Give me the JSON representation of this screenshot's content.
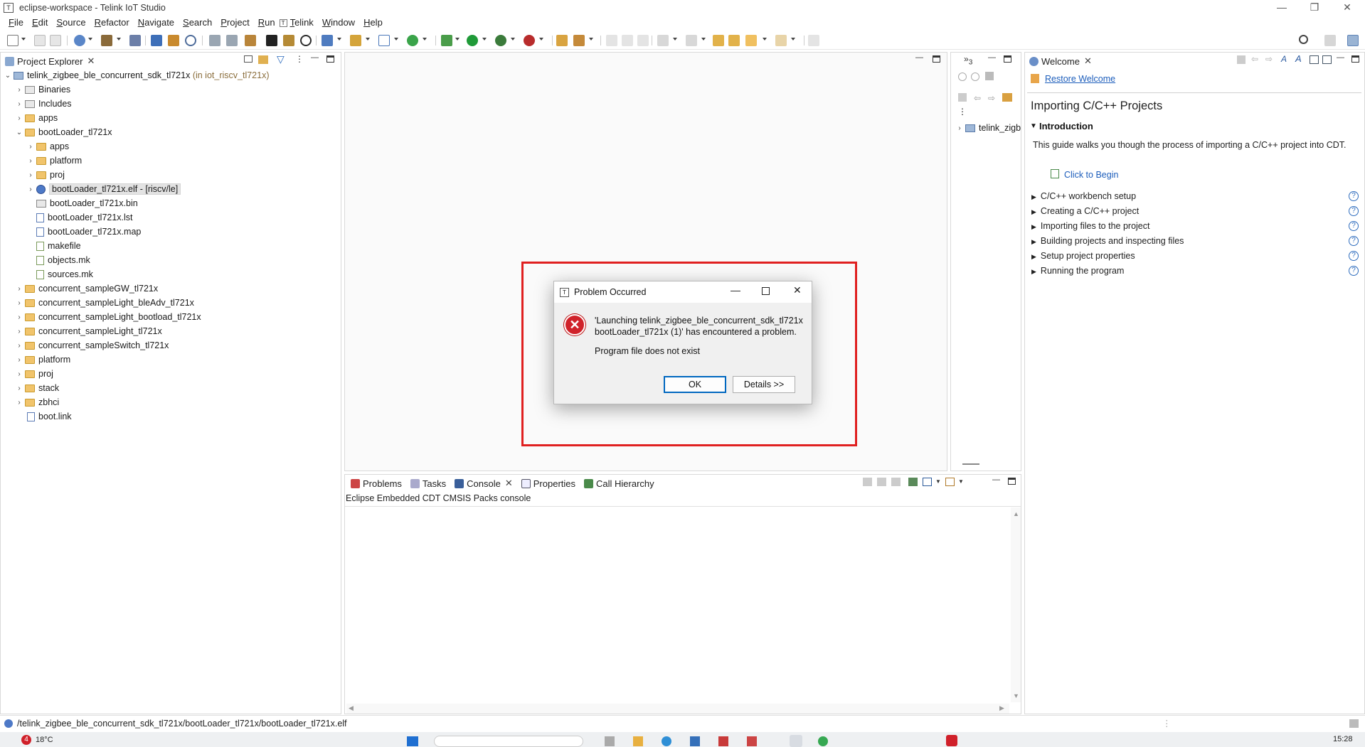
{
  "window": {
    "title": "eclipse-workspace - Telink IoT Studio",
    "app_icon": "T",
    "controls": [
      "—",
      "❐",
      "✕"
    ]
  },
  "menu": {
    "items": [
      "File",
      "Edit",
      "Source",
      "Refactor",
      "Navigate",
      "Search",
      "Project",
      "Run",
      "Telink",
      "Window",
      "Help"
    ]
  },
  "project_explorer": {
    "tab_label": "Project Explorer",
    "root": {
      "name": "telink_zigbee_ble_concurrent_sdk_tl721x",
      "suffix": "(in iot_riscv_tl721x)"
    },
    "items": [
      {
        "label": "Binaries"
      },
      {
        "label": "Includes"
      },
      {
        "label": "apps"
      },
      {
        "label": "bootLoader_tl721x"
      },
      {
        "label": "apps"
      },
      {
        "label": "platform"
      },
      {
        "label": "proj"
      },
      {
        "label": "bootLoader_tl721x.elf - [riscv/le]"
      },
      {
        "label": "bootLoader_tl721x.bin"
      },
      {
        "label": "bootLoader_tl721x.lst"
      },
      {
        "label": "bootLoader_tl721x.map"
      },
      {
        "label": "makefile"
      },
      {
        "label": "objects.mk"
      },
      {
        "label": "sources.mk"
      },
      {
        "label": "concurrent_sampleGW_tl721x"
      },
      {
        "label": "concurrent_sampleLight_bleAdv_tl721x"
      },
      {
        "label": "concurrent_sampleLight_bootload_tl721x"
      },
      {
        "label": "concurrent_sampleLight_tl721x"
      },
      {
        "label": "concurrent_sampleSwitch_tl721x"
      },
      {
        "label": "platform"
      },
      {
        "label": "proj"
      },
      {
        "label": "stack"
      },
      {
        "label": "zbhci"
      },
      {
        "label": "boot.link"
      }
    ]
  },
  "outline": {
    "tab_number": "3",
    "tree_item": "telink_zigb"
  },
  "welcome": {
    "tab_label": "Welcome",
    "restore_link": "Restore Welcome",
    "heading": "Importing C/C++ Projects",
    "section": "Introduction",
    "intro_text": "This guide walks you though the process of importing a C/C++ project into CDT.",
    "begin_link": "Click to Begin",
    "items": [
      "C/C++ workbench setup",
      "Creating a C/C++ project",
      "Importing files to the project",
      "Building projects and inspecting files",
      "Setup project properties",
      "Running the program"
    ]
  },
  "bottom_panel": {
    "tabs": [
      "Problems",
      "Tasks",
      "Console",
      "Properties",
      "Call Hierarchy"
    ],
    "console_title": "Eclipse Embedded CDT CMSIS Packs console"
  },
  "dialog": {
    "title": "Problem Occurred",
    "message": "'Launching telink_zigbee_ble_concurrent_sdk_tl721x bootLoader_tl721x (1)' has encountered a problem.",
    "detail": "Program file does not exist",
    "ok_label": "OK",
    "details_label": "Details >>"
  },
  "status": {
    "path": "/telink_zigbee_ble_concurrent_sdk_tl721x/bootLoader_tl721x/bootLoader_tl721x.elf"
  },
  "taskbar": {
    "badge": "4",
    "weather": "18°C",
    "time": "15:28"
  }
}
